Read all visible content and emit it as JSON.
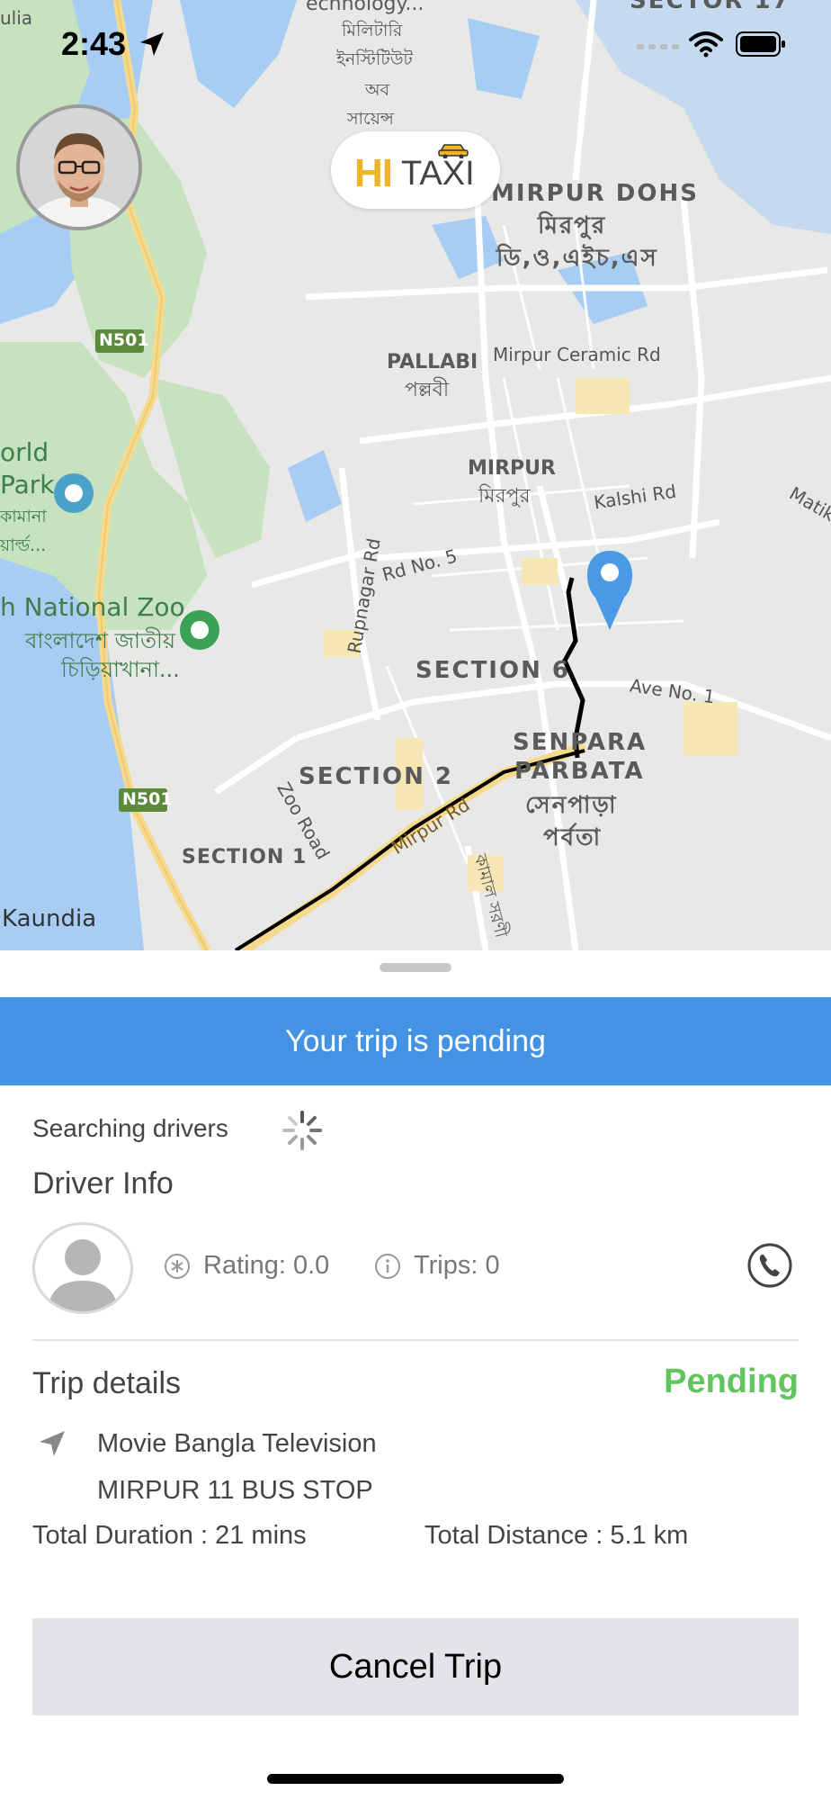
{
  "status_bar": {
    "time": "2:43"
  },
  "app": {
    "logo_hi": "HI",
    "logo_taxi": "TAXI"
  },
  "map": {
    "labels": {
      "top_left_fragment": "ulia",
      "top_fragment": "echnology...",
      "bn_military": "মিলিটারি",
      "bn_institute": "ইনস্টিটিউট",
      "bn_of": "অব",
      "bn_science": "সায়েন্স",
      "sector17": "SECTOR 17",
      "mirpur_dohs": "MIRPUR DOHS",
      "mirpur_dohs_bn1": "মিরপুর",
      "mirpur_dohs_bn2": "ডি,ও,এইচ,এস",
      "n501_top": "N501",
      "pallabi": "PALLABI",
      "pallabi_bn": "পল্লবী",
      "mirpur_ceramic": "Mirpur Ceramic Rd",
      "world": "orld",
      "park": "Park",
      "park_bn1": "কামানা",
      "park_bn2": "য়ার্ল্ড...",
      "mirpur": "MIRPUR",
      "mirpur_bn": "মিরপুর",
      "kalshi": "Kalshi Rd",
      "matik": "Matik",
      "rd_no5": "Rd No. 5",
      "rupnagar": "Rupnagar Rd",
      "zoo": "h National Zoo",
      "zoo_bn1": "বাংলাদেশ জাতীয়",
      "zoo_bn2": "চিড়িয়াখানা...",
      "section6": "SECTION 6",
      "ave_no1": "Ave No. 1",
      "senpara": "SENPARA",
      "parbata": "PARBATA",
      "senpara_bn": "সেনপাড়া",
      "parbata_bn": "পর্বতা",
      "n501_bottom": "N501",
      "section2": "SECTION 2",
      "zoo_road": "Zoo Road",
      "section1": "SECTION 1",
      "mirpur_rd": "Mirpur Rd",
      "kamal": "কামাল সরণী",
      "kaundia": "Kaundia"
    }
  },
  "banner": {
    "text": "Your trip is pending"
  },
  "driver": {
    "searching": "Searching drivers",
    "section_title": "Driver Info",
    "rating": "Rating: 0.0",
    "trips": "Trips: 0"
  },
  "trip": {
    "section_title": "Trip details",
    "status": "Pending",
    "pickup": "Movie Bangla Television",
    "dropoff": "MIRPUR 11 BUS STOP",
    "duration": "Total Duration : 21 mins",
    "distance": "Total Distance : 5.1 km"
  },
  "actions": {
    "cancel": "Cancel Trip"
  },
  "colors": {
    "banner": "#4492e3",
    "pending": "#62c35f",
    "pin": "#4a9ae6"
  }
}
